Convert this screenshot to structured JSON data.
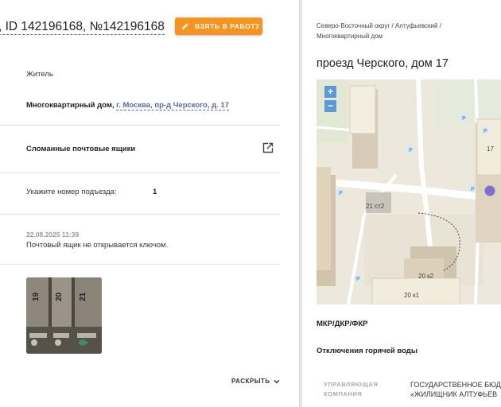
{
  "header": {
    "title": ", ID 142196168, №142196168",
    "take_button": "ВЗЯТЬ В РАБОТУ"
  },
  "request": {
    "applicant_type": "Житель",
    "object_type": "Многоквартирный дом,",
    "address_link": "г. Москва, пр-д Черского, д. 17",
    "category": "Сломанные почтовые ящики",
    "entrance_label": "Укажите номер подъезда:",
    "entrance_value": "1",
    "comment_date": "22.08.2025 11:39",
    "comment_text": "Почтовый ящик не открывается ключом.",
    "expand_label": "РАСКРЫТЬ"
  },
  "photo": {
    "box_numbers": [
      "19",
      "20",
      "21"
    ]
  },
  "right_panel": {
    "breadcrumb_line1": "Северо-Восточный округ / Алтуфьевский /",
    "breadcrumb_line2": "Многоквартирный дом",
    "title": "проезд Черского, дом 17",
    "map": {
      "zoom_in": "+",
      "zoom_out": "−",
      "labels": [
        "21 ст2",
        "20 к2",
        "20 к1",
        "17"
      ]
    },
    "section_mkr": "МКР/ДКР/ФКР",
    "section_hot_water": "Отключения горячей воды",
    "mgmt_label_line1": "УПРАВЛЯЮЩАЯ",
    "mgmt_label_line2": "КОМПАНИЯ",
    "mgmt_value_line1": "ГОСУДАРСТВЕННОЕ БЮД",
    "mgmt_value_line2": "«ЖИЛИЩНИК АЛТУФЬЕВ"
  },
  "colors": {
    "accent_orange": "#f7931e",
    "link_blue": "#5869b8",
    "map_marker": "#7b6fd6",
    "map_zoom": "#5b9bd5"
  }
}
